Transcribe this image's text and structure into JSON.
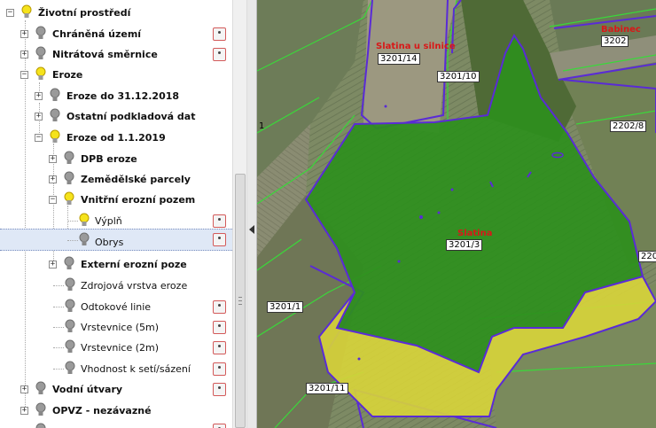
{
  "tree": {
    "items": [
      {
        "label": "Životní prostředí",
        "bold": true
      },
      {
        "label": "Chráněná území",
        "bold": true
      },
      {
        "label": "Nitrátová směrnice",
        "bold": true
      },
      {
        "label": "Eroze",
        "bold": true
      },
      {
        "label": "Eroze do 31.12.2018",
        "bold": true
      },
      {
        "label": "Ostatní podkladová dat",
        "bold": true
      },
      {
        "label": "Eroze od 1.1.2019",
        "bold": true
      },
      {
        "label": "DPB eroze",
        "bold": true
      },
      {
        "label": "Zemědělské parcely",
        "bold": true
      },
      {
        "label": "Vnitřní erozní pozem",
        "bold": true
      },
      {
        "label": "Výplň",
        "bold": false
      },
      {
        "label": "Obrys",
        "bold": false
      },
      {
        "label": "Externí erozní poze",
        "bold": true
      },
      {
        "label": "Zdrojová vrstva eroze",
        "bold": false
      },
      {
        "label": "Odtokové linie",
        "bold": false
      },
      {
        "label": "Vrstevnice (5m)",
        "bold": false
      },
      {
        "label": "Vrstevnice (2m)",
        "bold": false
      },
      {
        "label": "Vhodnost k setí/sázení",
        "bold": false
      },
      {
        "label": "Vodní útvary",
        "bold": true
      },
      {
        "label": "OPVZ - nezávazné",
        "bold": true
      }
    ]
  },
  "map": {
    "parcels": [
      "3201/14",
      "3201/10",
      "3202",
      "2202/8",
      "3201/3",
      "3201/1",
      "3201/11",
      "220",
      "1"
    ],
    "names": [
      "Slatina u silnice",
      "Slatina",
      "Babinec"
    ]
  },
  "colors": {
    "selection": "#dfe8f6",
    "erosion_fill": "#2e8f1d",
    "erosion_outline": "#5a2bd6",
    "yellow_fill": "#d8d43a",
    "boundary_green": "#3ad83a",
    "label_red": "#d81818"
  }
}
